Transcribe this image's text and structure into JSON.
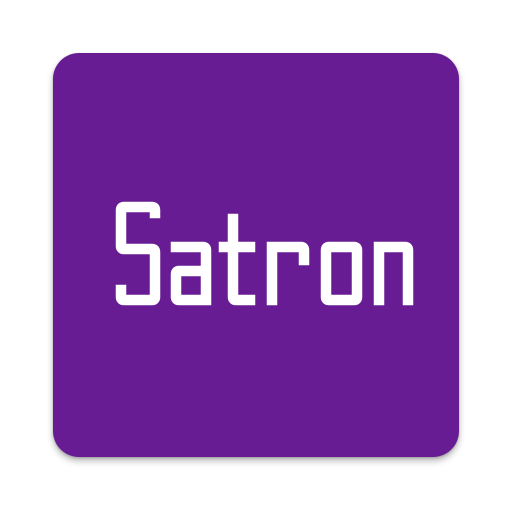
{
  "app_icon": {
    "wordmark": "Satron",
    "background_color": "#681c94",
    "text_color": "#ffffff",
    "page_background": "#ffffff"
  }
}
